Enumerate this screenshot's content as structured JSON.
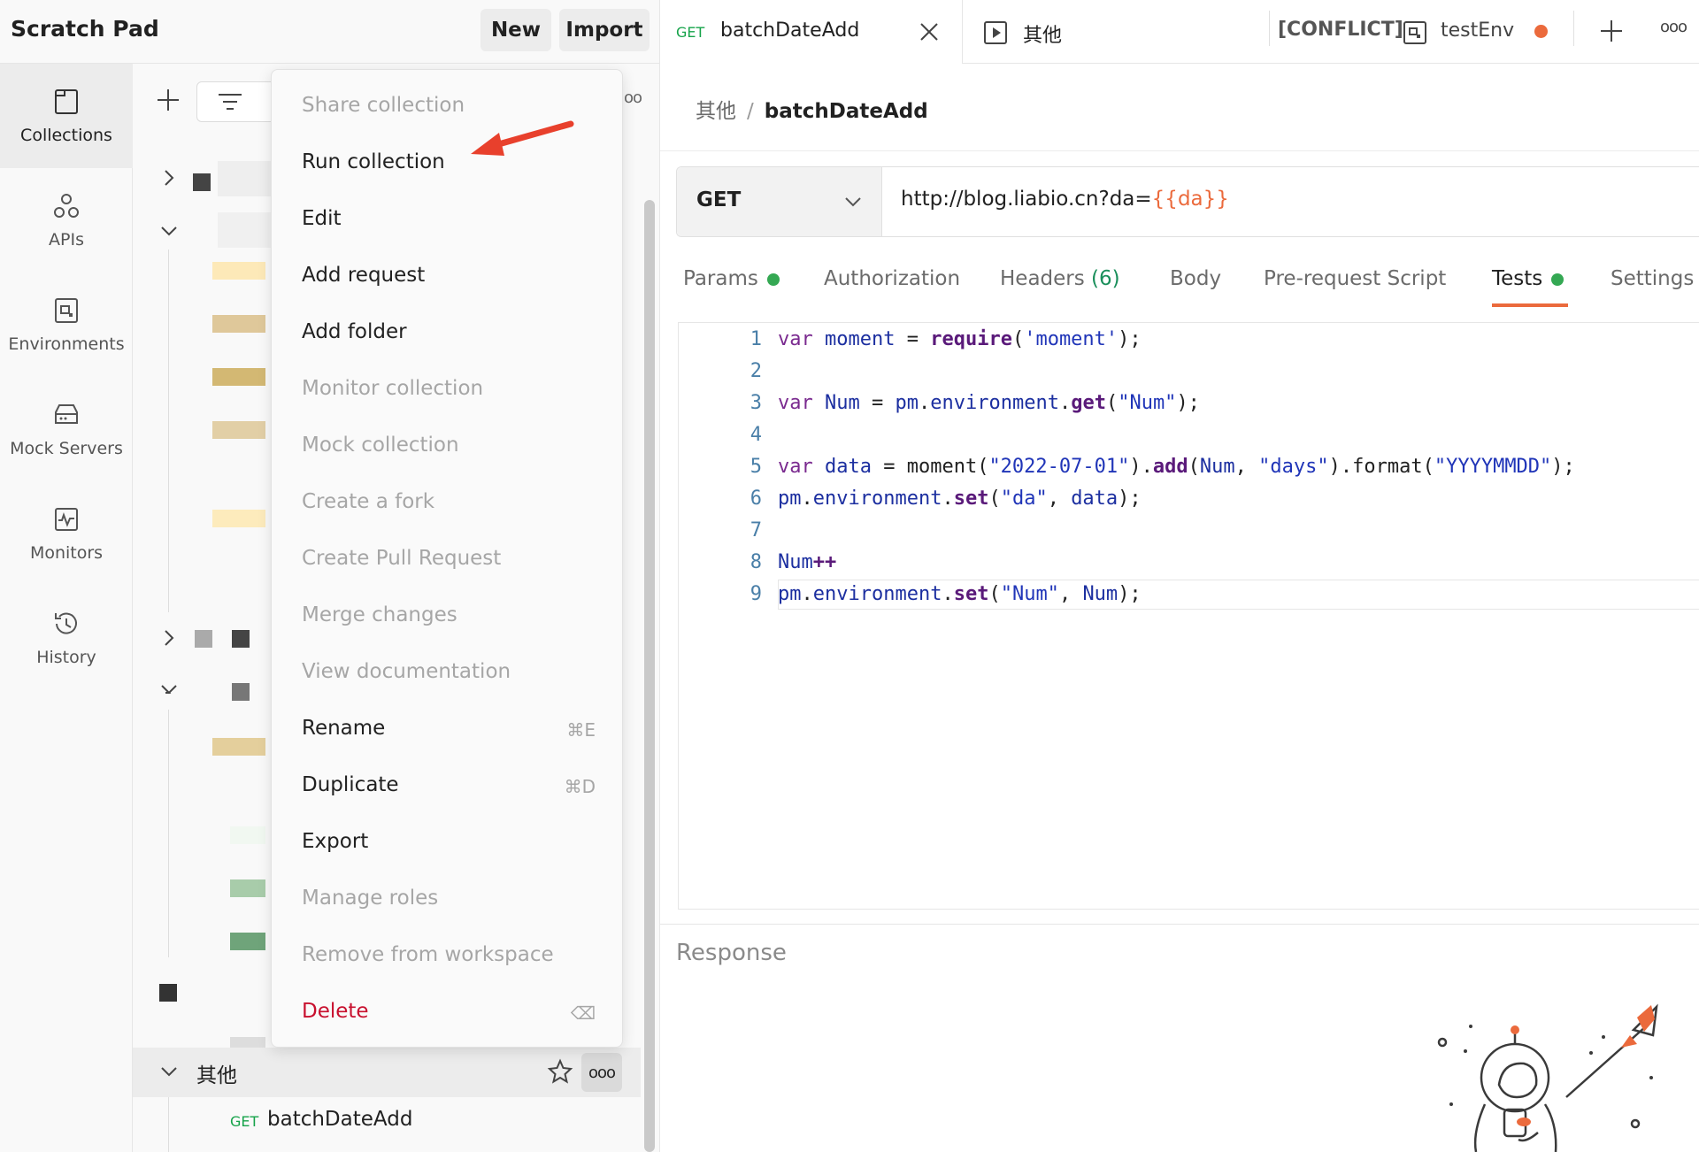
{
  "workspace": {
    "title": "Scratch Pad",
    "new_label": "New",
    "import_label": "Import"
  },
  "sidebar": {
    "items": [
      {
        "label": "Collections",
        "icon": "collections-icon",
        "active": true
      },
      {
        "label": "APIs",
        "icon": "apis-icon"
      },
      {
        "label": "Environments",
        "icon": "environments-icon"
      },
      {
        "label": "Mock Servers",
        "icon": "mock-servers-icon"
      },
      {
        "label": "Monitors",
        "icon": "monitors-icon"
      },
      {
        "label": "History",
        "icon": "history-icon"
      }
    ]
  },
  "context_menu": {
    "items": [
      {
        "label": "Share collection",
        "disabled": true
      },
      {
        "label": "Run collection"
      },
      {
        "label": "Edit"
      },
      {
        "label": "Add request"
      },
      {
        "label": "Add folder"
      },
      {
        "label": "Monitor collection",
        "disabled": true
      },
      {
        "label": "Mock collection",
        "disabled": true
      },
      {
        "label": "Create a fork",
        "disabled": true
      },
      {
        "label": "Create Pull Request",
        "disabled": true
      },
      {
        "label": "Merge changes",
        "disabled": true
      },
      {
        "label": "View documentation",
        "disabled": true
      },
      {
        "label": "Rename",
        "shortcut": "⌘E"
      },
      {
        "label": "Duplicate",
        "shortcut": "⌘D"
      },
      {
        "label": "Export"
      },
      {
        "label": "Manage roles",
        "disabled": true
      },
      {
        "label": "Remove from workspace",
        "disabled": true
      },
      {
        "label": "Delete",
        "danger": true,
        "shortcut": "⌫"
      }
    ]
  },
  "tree": {
    "folder_label": "其他",
    "request": {
      "method": "GET",
      "name": "batchDateAdd"
    },
    "more_label": "ooo"
  },
  "tabs": {
    "active": {
      "method": "GET",
      "name": "batchDateAdd"
    },
    "second": {
      "name": "其他"
    },
    "conflict_label": "[CONFLICT]",
    "env_name": "testEnv",
    "more_label": "ooo"
  },
  "breadcrumb": {
    "parent": "其他",
    "separator": "/",
    "current": "batchDateAdd"
  },
  "request": {
    "method": "GET",
    "url_prefix": "http://blog.liabio.cn?da=",
    "url_variable": "{{da}}"
  },
  "request_tabs": {
    "params": "Params",
    "authorization": "Authorization",
    "headers": "Headers",
    "headers_count": "(6)",
    "body": "Body",
    "pre_request": "Pre-request Script",
    "tests": "Tests",
    "settings": "Settings"
  },
  "code": {
    "line_numbers": [
      "1",
      "2",
      "3",
      "4",
      "5",
      "6",
      "7",
      "8",
      "9"
    ]
  },
  "response": {
    "title": "Response"
  },
  "colors": {
    "accent": "#eb6a3c",
    "success": "#34a853",
    "danger": "#c8102e",
    "method_get": "#16a34a"
  }
}
